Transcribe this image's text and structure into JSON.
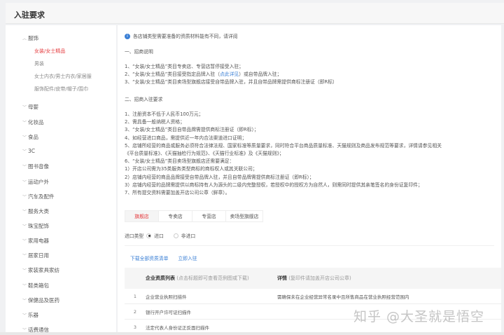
{
  "header": {
    "title": "入驻要求"
  },
  "sidebar": {
    "categories": [
      {
        "label": "服饰",
        "expanded": true,
        "subs": [
          {
            "label": "女装/女士精品",
            "active": true
          },
          {
            "label": "男装"
          },
          {
            "label": "女士内衣/男士内衣/家居服"
          },
          {
            "label": "服饰配件/皮带/帽子/围巾"
          }
        ]
      },
      {
        "label": "母婴"
      },
      {
        "label": "化妆品"
      },
      {
        "label": "食品"
      },
      {
        "label": "3C"
      },
      {
        "label": "图书音像"
      },
      {
        "label": "运动户外"
      },
      {
        "label": "汽车及配件"
      },
      {
        "label": "服务大类"
      },
      {
        "label": "珠宝配饰"
      },
      {
        "label": "家用电器"
      },
      {
        "label": "居家日用"
      },
      {
        "label": "家装家具家纺"
      },
      {
        "label": "鞋类箱包"
      },
      {
        "label": "保健品及医药"
      },
      {
        "label": "乐器"
      },
      {
        "label": "话费通信"
      }
    ]
  },
  "notice": "各店铺类型需要准备的资质材料能有不同，请详阅",
  "section1": {
    "title": "一、招商说明",
    "lines": [
      "1、“女装/女士精品”类目专卖店、专营店暂停接受入驻；",
      "2、“女装/女士精品”类目接受指定品牌入驻（",
      "点此详见",
      "）或自带品牌入驻；",
      "3、“女装/女士精品”类目卖场型旗舰店接受自带品牌入驻，并且自带品牌需提供商标注册证（即R标）"
    ]
  },
  "section2": {
    "title": "二、招商入驻要求",
    "lines": [
      "1、注册资本不低于人民币100万元；",
      "2、需具备一般纳税人资格；",
      "3、“女装/女士精品”类目自带品牌需提供商标注册证（即R标）；",
      "4、如经营进口商品，需提供近一年内合法渠道进口证明；",
      "5、店铺所经营的商品或服务必须符合法律法规、国家标准等质量要求，同时符合平台商品质量标准、天猫规则及商品发布规范等要求，详情请参见相关",
      "《平台质量标准》、《天猫抽检行为规范》、《天猫行业标准》及《天猫规则》；",
      "6、“女装/女士精品”类目卖场型旗舰店还需要满足：",
      "1）开店公司需为35类服务类型商标的商标权人或其关联公司；",
      "2）店铺内经营的商品品牌接受自带品牌入驻，并且自带品牌需提供商标注册证（即R标）；",
      "3）店铺内经营的品牌需提供以商标持有人为源头的二级内完整授权，若授权中的授权方为自然人，则需同时提供其亲笔签名的身份证复印件；",
      "7、所有提交资料需要加盖开店公司公章（鲜章）。"
    ]
  },
  "tabs": [
    {
      "label": "旗舰店",
      "active": true
    },
    {
      "label": "专卖店"
    },
    {
      "label": "专营店"
    },
    {
      "label": "卖场型旗舰店"
    }
  ],
  "import_type": {
    "label": "进口类型",
    "options": [
      {
        "label": "进口",
        "checked": true
      },
      {
        "label": "非进口"
      }
    ]
  },
  "actions": {
    "download": "下载全部资质清单",
    "apply": "立即入驻"
  },
  "table": {
    "col1_title": "企业资质列表",
    "col1_note": "(点击标题即可查看范例图或下载)",
    "col2_title": "详情",
    "col2_note": "(复印件请加盖开店公司公章)",
    "rows": [
      {
        "no": "1",
        "name": "企业营业执照扫描件",
        "detail": "需确保未在企业经营异常名录中且所售商品在营业执照经营范围内"
      },
      {
        "no": "2",
        "name": "银行开户许可证扫描件",
        "detail": ""
      },
      {
        "no": "3",
        "name": "法定代表人身份证正反面扫描件",
        "detail": ""
      }
    ]
  },
  "watermark": "知乎 @大圣就是悟空",
  "colors": {
    "accent": "#e4393c",
    "link": "#3a7fd5"
  }
}
